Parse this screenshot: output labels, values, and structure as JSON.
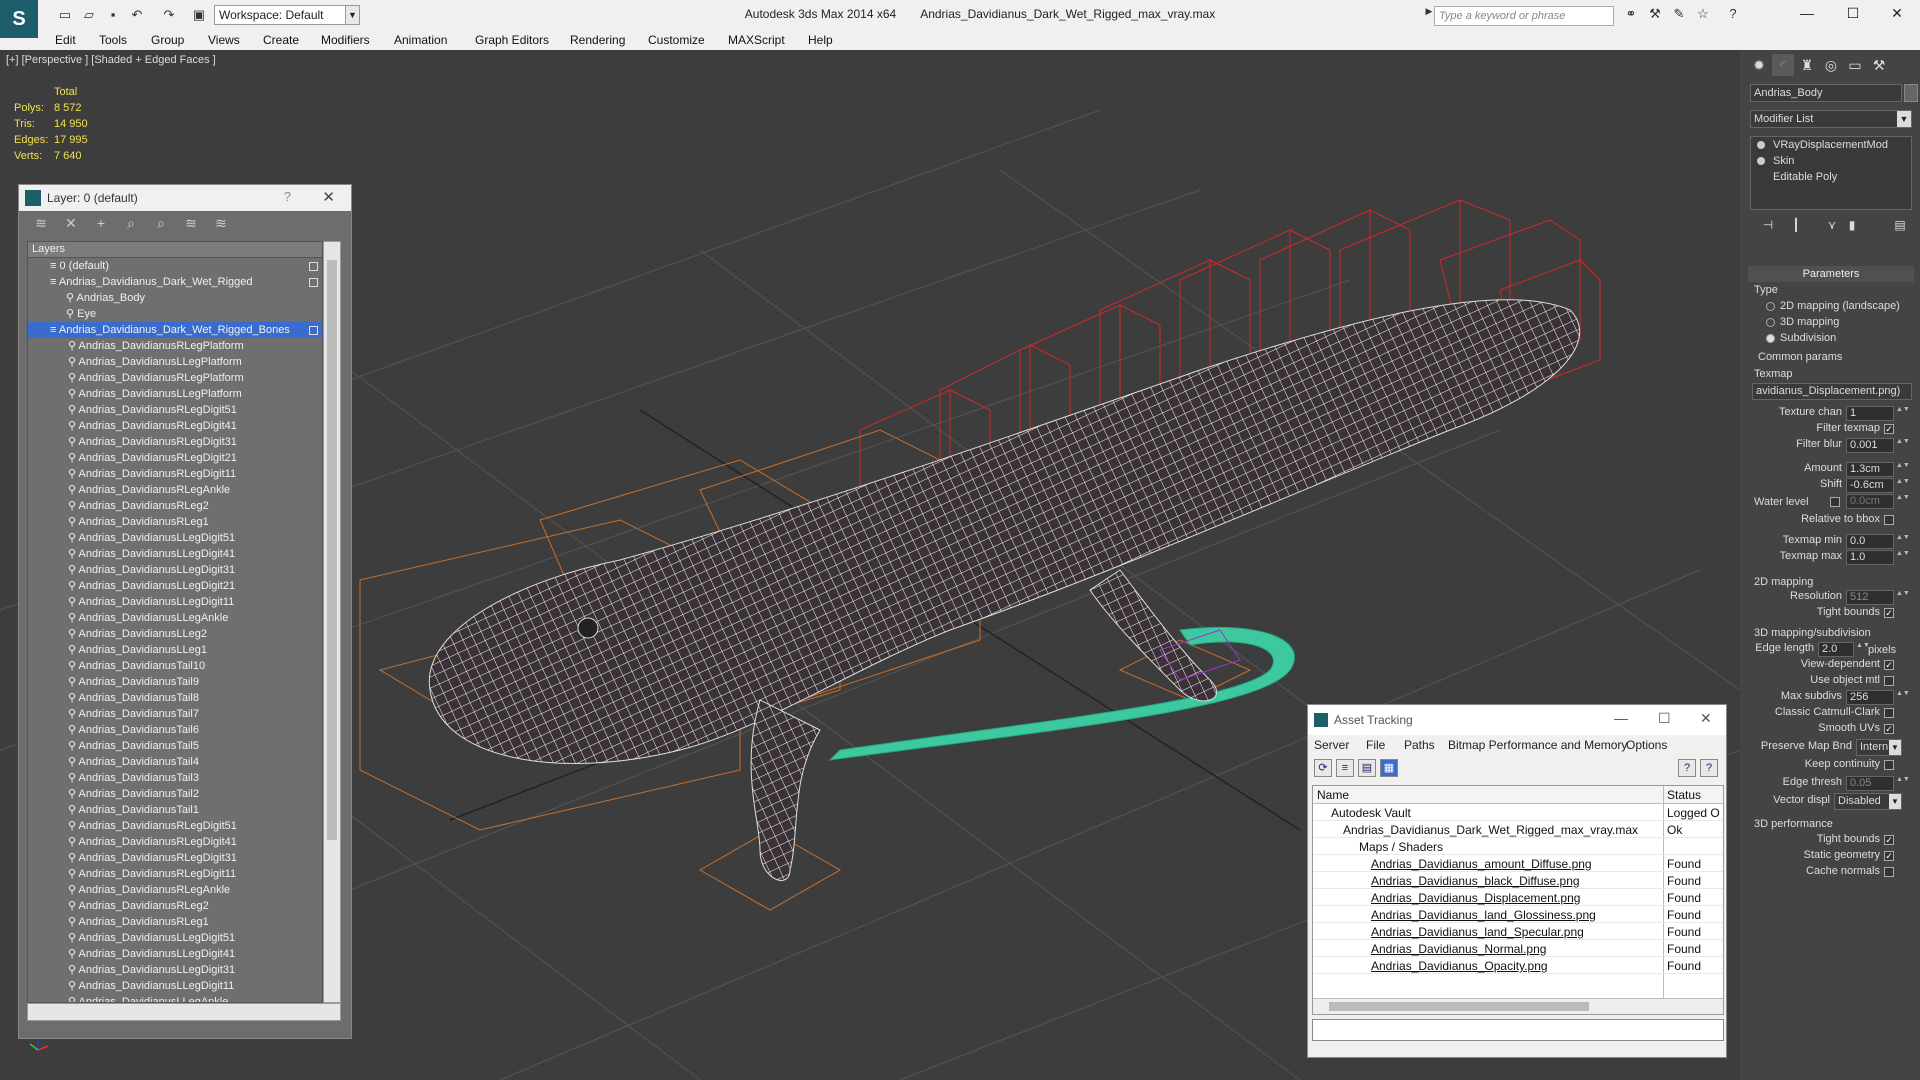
{
  "titlebar": {
    "app_title": "Autodesk 3ds Max  2014 x64",
    "file_title": "Andrias_Davidianus_Dark_Wet_Rigged_max_vray.max",
    "workspace": "Workspace: Default",
    "search_placeholder": "Type a keyword or phrase"
  },
  "menu": [
    "Edit",
    "Tools",
    "Group",
    "Views",
    "Create",
    "Modifiers",
    "Animation",
    "Graph Editors",
    "Rendering",
    "Customize",
    "MAXScript",
    "Help"
  ],
  "viewport": {
    "label": "[+] [Perspective ] [Shaded + Edged Faces ]",
    "stats": {
      "header": "Total",
      "rows": [
        {
          "label": "Polys:",
          "value": "8 572"
        },
        {
          "label": "Tris:",
          "value": "14 950"
        },
        {
          "label": "Edges:",
          "value": "17 995"
        },
        {
          "label": "Verts:",
          "value": "7 640"
        }
      ]
    }
  },
  "layer_panel": {
    "title": "Layer: 0 (default)",
    "help": "?",
    "column": "Layers",
    "rows": [
      "0 (default)",
      "Andrias_Davidianus_Dark_Wet_Rigged",
      "Andrias_Body",
      "Eye",
      "Andrias_Davidianus_Dark_Wet_Rigged_Bones",
      "Andrias_DavidianusRLegPlatform",
      "Andrias_DavidianusLLegPlatform",
      "Andrias_DavidianusRLegPlatform",
      "Andrias_DavidianusLLegPlatform",
      "Andrias_DavidianusRLegDigit51",
      "Andrias_DavidianusRLegDigit41",
      "Andrias_DavidianusRLegDigit31",
      "Andrias_DavidianusRLegDigit21",
      "Andrias_DavidianusRLegDigit11",
      "Andrias_DavidianusRLegAnkle",
      "Andrias_DavidianusRLeg2",
      "Andrias_DavidianusRLeg1",
      "Andrias_DavidianusLLegDigit51",
      "Andrias_DavidianusLLegDigit41",
      "Andrias_DavidianusLLegDigit31",
      "Andrias_DavidianusLLegDigit21",
      "Andrias_DavidianusLLegDigit11",
      "Andrias_DavidianusLLegAnkle",
      "Andrias_DavidianusLLeg2",
      "Andrias_DavidianusLLeg1",
      "Andrias_DavidianusTail10",
      "Andrias_DavidianusTail9",
      "Andrias_DavidianusTail8",
      "Andrias_DavidianusTail7",
      "Andrias_DavidianusTail6",
      "Andrias_DavidianusTail5",
      "Andrias_DavidianusTail4",
      "Andrias_DavidianusTail3",
      "Andrias_DavidianusTail2",
      "Andrias_DavidianusTail1",
      "Andrias_DavidianusRLegDigit51",
      "Andrias_DavidianusRLegDigit41",
      "Andrias_DavidianusRLegDigit31",
      "Andrias_DavidianusRLegDigit11",
      "Andrias_DavidianusRLegAnkle",
      "Andrias_DavidianusRLeg2",
      "Andrias_DavidianusRLeg1",
      "Andrias_DavidianusLLegDigit51",
      "Andrias_DavidianusLLegDigit41",
      "Andrias_DavidianusLLegDigit31",
      "Andrias_DavidianusLLegDigit11",
      "Andrias_DavidianusLLegAnkle"
    ]
  },
  "asset_tracking": {
    "title": "Asset Tracking",
    "menu": [
      "Server",
      "File",
      "Paths",
      "Bitmap Performance and Memory",
      "Options"
    ],
    "col_name": "Name",
    "col_status": "Status",
    "rows": [
      {
        "name": "Autodesk Vault",
        "status": "Logged O"
      },
      {
        "name": "Andrias_Davidianus_Dark_Wet_Rigged_max_vray.max",
        "status": "Ok"
      },
      {
        "name": "Maps / Shaders",
        "status": ""
      },
      {
        "name": "Andrias_Davidianus_amount_Diffuse.png",
        "status": "Found"
      },
      {
        "name": "Andrias_Davidianus_black_Diffuse.png",
        "status": "Found"
      },
      {
        "name": "Andrias_Davidianus_Displacement.png",
        "status": "Found"
      },
      {
        "name": "Andrias_Davidianus_land_Glossiness.png",
        "status": "Found"
      },
      {
        "name": "Andrias_Davidianus_land_Specular.png",
        "status": "Found"
      },
      {
        "name": "Andrias_Davidianus_Normal.png",
        "status": "Found"
      },
      {
        "name": "Andrias_Davidianus_Opacity.png",
        "status": "Found"
      }
    ]
  },
  "command_panel": {
    "object_name": "Andrias_Body",
    "modifier_list": "Modifier List",
    "stack": [
      "VRayDisplacementMod",
      "Skin",
      "Editable Poly"
    ],
    "parameters": "Parameters",
    "type_label": "Type",
    "type_options": [
      "2D mapping (landscape)",
      "3D mapping",
      "Subdivision"
    ],
    "common_params": "Common params",
    "texmap_label": "Texmap",
    "texmap_value": "avidianus_Displacement.png)",
    "texture_chan_label": "Texture chan",
    "texture_chan": "1",
    "filter_texmap_label": "Filter texmap",
    "filter_blur_label": "Filter blur",
    "filter_blur": "0.001",
    "amount_label": "Amount",
    "amount": "1.3cm",
    "shift_label": "Shift",
    "shift": "-0.6cm",
    "water_level_label": "Water level",
    "water_level": "0.0cm",
    "relative_bbox_label": "Relative to bbox",
    "texmap_min_label": "Texmap min",
    "texmap_min": "0.0",
    "texmap_max_label": "Texmap max",
    "texmap_max": "1.0",
    "mapping2d": "2D mapping",
    "resolution_label": "Resolution",
    "resolution": "512",
    "tight_bounds_label": "Tight bounds",
    "mapping3d": "3D mapping/subdivision",
    "edge_length_label": "Edge length",
    "edge_length": "2.0",
    "pixels_label": "pixels",
    "view_dependent_label": "View-dependent",
    "use_object_mtl_label": "Use object mtl",
    "max_subdivs_label": "Max subdivs",
    "max_subdivs": "256",
    "classic_catmull_label": "Classic Catmull-Clark",
    "smooth_uvs_label": "Smooth UVs",
    "preserve_map_bnd_label": "Preserve Map Bnd",
    "preserve_map_bnd": "Intern",
    "keep_continuity_label": "Keep continuity",
    "edge_thresh_label": "Edge thresh",
    "edge_thresh": "0.05",
    "vector_displ_label": "Vector displ",
    "vector_displ": "Disabled",
    "perf_label": "3D performance",
    "perf_tight_bounds_label": "Tight bounds",
    "static_geometry_label": "Static geometry",
    "cache_normals_label": "Cache normals"
  }
}
